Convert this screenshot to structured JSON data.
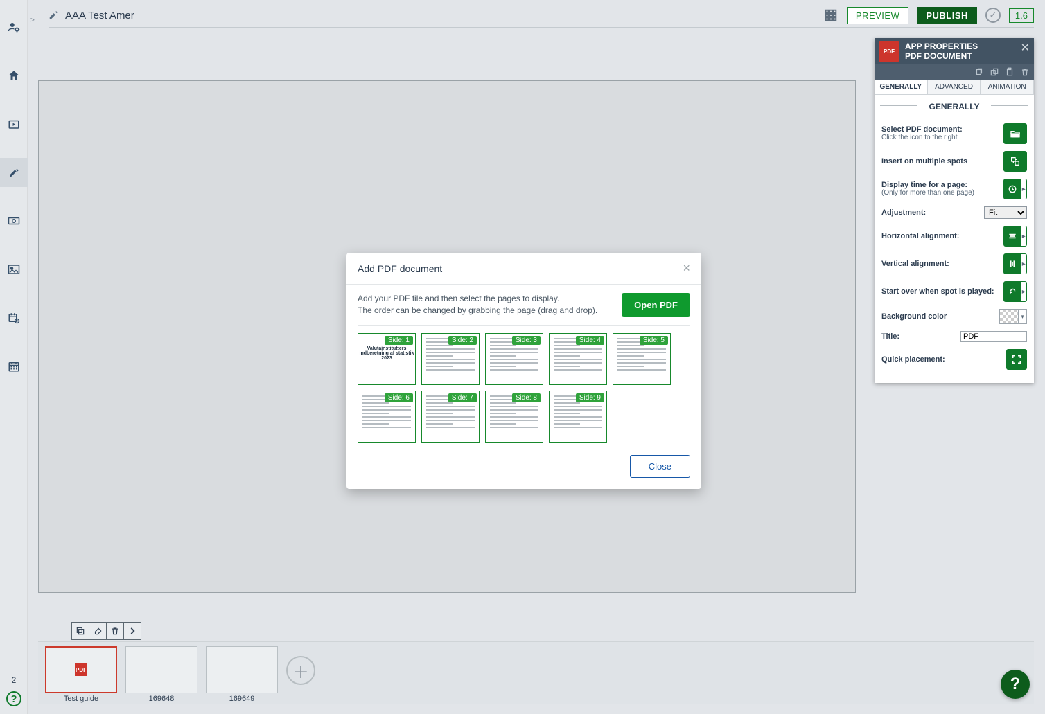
{
  "header": {
    "title": "AAA Test Amer",
    "preview": "PREVIEW",
    "publish": "PUBLISH",
    "version": "1.6"
  },
  "right_panel": {
    "heading_line1": "APP PROPERTIES",
    "heading_line2": "PDF DOCUMENT",
    "tabs": {
      "generally": "GENERALLY",
      "advanced": "ADVANCED",
      "animation": "ANIMATION"
    },
    "section": "GENERALLY",
    "rows": {
      "select_doc_1": "Select PDF document:",
      "select_doc_2": "Click the icon to the right",
      "multiple_spots": "Insert on multiple spots",
      "display_time_1": "Display time for a page:",
      "display_time_2": "(Only for more than one page)",
      "adjustment": "Adjustment:",
      "adjustment_value": "Fit",
      "h_align": "Horizontal alignment:",
      "v_align": "Vertical alignment:",
      "start_over": "Start over when spot is played:",
      "bg_color": "Background color",
      "title_label": "Title:",
      "title_value": "PDF",
      "quick_placement": "Quick placement:"
    }
  },
  "modal": {
    "title": "Add PDF document",
    "instr_line1": "Add your PDF file and then select the pages to display.",
    "instr_line2": "The order can be changed by grabbing the page (drag and drop).",
    "open_btn": "Open PDF",
    "close_btn": "Close",
    "pages": [
      {
        "label": "Side: 1",
        "cover": true,
        "cover_title": "Valutainstitutters indberetning af statistik 2023"
      },
      {
        "label": "Side: 2"
      },
      {
        "label": "Side: 3"
      },
      {
        "label": "Side: 4"
      },
      {
        "label": "Side: 5"
      },
      {
        "label": "Side: 6"
      },
      {
        "label": "Side: 7"
      },
      {
        "label": "Side: 8"
      },
      {
        "label": "Side: 9"
      }
    ]
  },
  "slides": {
    "count": "2",
    "items": [
      {
        "label": "Test guide"
      },
      {
        "label": "169648"
      },
      {
        "label": "169649"
      }
    ]
  }
}
